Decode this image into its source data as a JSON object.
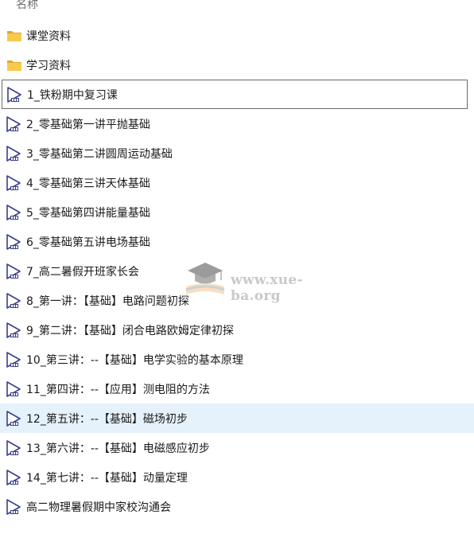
{
  "header": {
    "name_column": "名称"
  },
  "folders": [
    {
      "label": "课堂资料",
      "icon": "folder-icon"
    },
    {
      "label": "学习资料",
      "icon": "folder-icon"
    }
  ],
  "videos": [
    {
      "label": "1_铁粉期中复习课",
      "icon": "video-file-icon"
    },
    {
      "label": "2_零基础第一讲平抛基础",
      "icon": "video-file-icon"
    },
    {
      "label": "3_零基础第二讲圆周运动基础",
      "icon": "video-file-icon"
    },
    {
      "label": "4_零基础第三讲天体基础",
      "icon": "video-file-icon"
    },
    {
      "label": "5_零基础第四讲能量基础",
      "icon": "video-file-icon"
    },
    {
      "label": "6_零基础第五讲电场基础",
      "icon": "video-file-icon"
    },
    {
      "label": "7_高二暑假开班家长会",
      "icon": "video-file-icon"
    },
    {
      "label": "8_第一讲：【基础】电路问题初探",
      "icon": "video-file-icon"
    },
    {
      "label": "9_第二讲：【基础】闭合电路欧姆定律初探",
      "icon": "video-file-icon"
    },
    {
      "label": "10_第三讲：--【基础】电学实验的基本原理",
      "icon": "video-file-icon"
    },
    {
      "label": "11_第四讲：--【应用】测电阻的方法",
      "icon": "video-file-icon"
    },
    {
      "label": "12_第五讲：--【基础】磁场初步",
      "icon": "video-file-icon"
    },
    {
      "label": "13_第六讲：--【基础】电磁感应初步",
      "icon": "video-file-icon"
    },
    {
      "label": "14_第七讲：--【基础】动量定理",
      "icon": "video-file-icon"
    },
    {
      "label": "高二物理暑假期中家校沟通会",
      "icon": "video-file-icon"
    }
  ],
  "watermark": {
    "text": "www.xue-ba.org",
    "icon": "graduation-cap-book-icon"
  },
  "colors": {
    "folder": "#f8c94a",
    "folder_dark": "#e0a82e",
    "icon_stroke": "#3b3f8f",
    "highlight": "#e5f1fb",
    "outline": "#6a6a6a"
  }
}
